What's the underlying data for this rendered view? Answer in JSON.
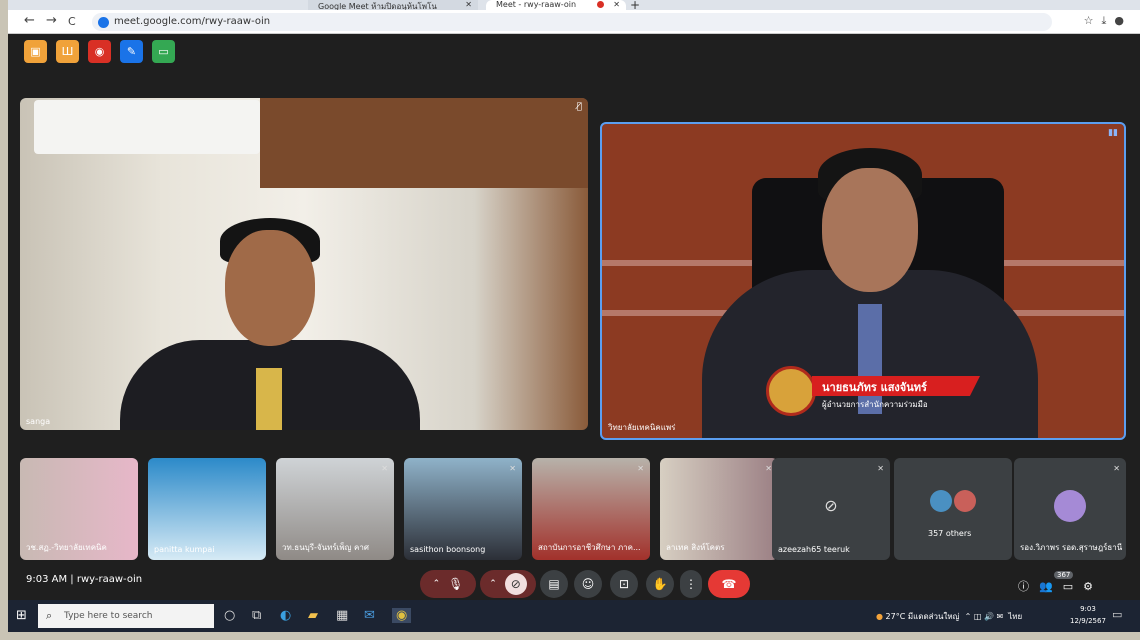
{
  "browser": {
    "tab1_title": "Google Meet ห้ามปิดอนุห้นโพโน",
    "tab2_title": "Meet - rwy-raaw-oin",
    "new_tab": "+",
    "url": "meet.google.com/rwy-raaw-oin",
    "nav": {
      "back": "←",
      "forward": "→",
      "reload": "C"
    }
  },
  "extensions": [
    {
      "icon": "no-camera-icon",
      "color": "#f0a23a",
      "glyph": "▣"
    },
    {
      "icon": "pillars-icon",
      "color": "#f0a23a",
      "glyph": "Ш"
    },
    {
      "icon": "record-icon",
      "color": "#d93025",
      "glyph": "◉"
    },
    {
      "icon": "edit-note-icon",
      "color": "#1a73e8",
      "glyph": "✎"
    },
    {
      "icon": "screen-icon",
      "color": "#34a853",
      "glyph": "▭"
    }
  ],
  "main_tiles": {
    "left_name": "sanga",
    "right_name": "วิทยาลัยเทคนิคแพร่",
    "nameplate_title": "นายธนภัทร แสงจันทร์",
    "nameplate_subtitle": "ผู้อำนวยการสำนักความร่วมมือ"
  },
  "participants": [
    {
      "name": "วช.สฏ.-วิทยาลัยเทคนิค"
    },
    {
      "name": "panitta kumpai"
    },
    {
      "name": "วท.ธนบุรี-จันทร์เพ็ญ คาศ"
    },
    {
      "name": "sasithon boonsong"
    },
    {
      "name": "สถาบันการอาชีวศึกษา ภาค..."
    },
    {
      "name": "ลาเทค สิงห์โคตร"
    },
    {
      "name": "azeezah65 teeruk"
    },
    {
      "name": "357 others"
    },
    {
      "name": "รอง.วิภาพร รอด.สุราษฎร์ธานี"
    }
  ],
  "meeting": {
    "time": "9:03 AM",
    "code": "rwy-raaw-oin",
    "separator": "|",
    "participant_count": "367"
  },
  "taskbar": {
    "search_placeholder": "Type here to search",
    "weather": "27°C มีแดดส่วนใหญ่",
    "lang": "ไทย",
    "clock_time": "9:03",
    "clock_date": "12/9/2567"
  }
}
